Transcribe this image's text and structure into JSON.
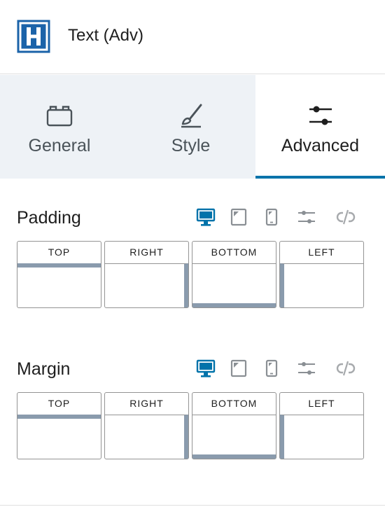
{
  "header": {
    "title": "Text (Adv)",
    "icon": "heading-h-icon",
    "icon_color": "#1b63a9"
  },
  "tabs": [
    {
      "label": "General",
      "icon": "briefcase-icon",
      "active": false
    },
    {
      "label": "Style",
      "icon": "brush-icon",
      "active": false
    },
    {
      "label": "Advanced",
      "icon": "sliders-icon",
      "active": true
    }
  ],
  "accent_color": "#0073aa",
  "padding": {
    "title": "Padding",
    "devices": [
      "desktop-icon",
      "tablet-icon",
      "mobile-icon",
      "settings-sliders-icon",
      "unlink-icon"
    ],
    "active_device": "desktop",
    "labels": {
      "top": "TOP",
      "right": "RIGHT",
      "bottom": "BOTTOM",
      "left": "LEFT"
    },
    "values": {
      "top": "",
      "right": "",
      "bottom": "",
      "left": ""
    }
  },
  "margin": {
    "title": "Margin",
    "devices": [
      "desktop-icon",
      "tablet-icon",
      "mobile-icon",
      "settings-sliders-icon",
      "unlink-icon"
    ],
    "active_device": "desktop",
    "labels": {
      "top": "TOP",
      "right": "RIGHT",
      "bottom": "BOTTOM",
      "left": "LEFT"
    },
    "values": {
      "top": "",
      "right": "",
      "bottom": "",
      "left": ""
    }
  }
}
